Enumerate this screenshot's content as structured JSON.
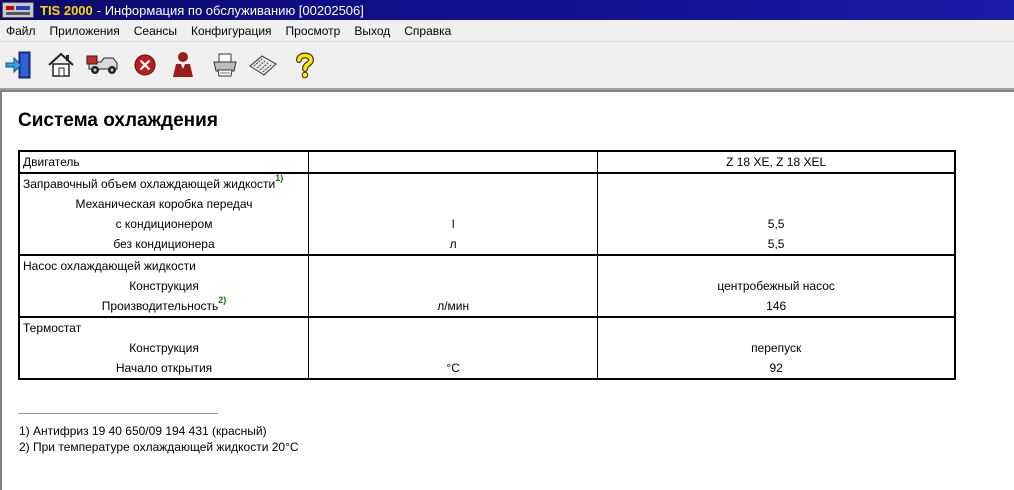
{
  "window": {
    "app_name": "TIS 2000",
    "title": "- Информация по обслуживанию [00202506]"
  },
  "menu": [
    "Файл",
    "Приложения",
    "Сеансы",
    "Конфигурация",
    "Просмотр",
    "Выход",
    "Справка"
  ],
  "toolbar": [
    {
      "icon": "exit-door-icon"
    },
    {
      "icon": "home-icon"
    },
    {
      "icon": "vehicle-icon"
    },
    {
      "icon": "stop-icon"
    },
    {
      "icon": "person-icon"
    },
    {
      "icon": "printer-icon"
    },
    {
      "icon": "keyboard-icon"
    },
    {
      "icon": "help-question-icon"
    }
  ],
  "page": {
    "title": "Система охлаждения",
    "header": {
      "col1": "Двигатель",
      "col2": "",
      "col3": "Z 18 XE, Z 18 XEL"
    },
    "groups": [
      {
        "rows": [
          {
            "label": "Заправочный объем охлаждающей жидкости",
            "sup": "1)",
            "unit": "",
            "value": ""
          },
          {
            "label": "Механическая коробка передач",
            "unit": "",
            "value": ""
          },
          {
            "label": "с кондиционером",
            "unit": "l",
            "value": "5,5"
          },
          {
            "label": "без кондиционера",
            "unit": "л",
            "value": "5,5"
          }
        ]
      },
      {
        "rows": [
          {
            "label": "Насос охлаждающей жидкости",
            "unit": "",
            "value": ""
          },
          {
            "label": "Конструкция",
            "unit": "",
            "value": "центробежный насос"
          },
          {
            "label": "Производительность",
            "sup": "2)",
            "unit": "л/мин",
            "value": "146"
          }
        ]
      },
      {
        "rows": [
          {
            "label": "Термостат",
            "unit": "",
            "value": ""
          },
          {
            "label": "Конструкция",
            "unit": "",
            "value": "перепуск"
          },
          {
            "label": "Начало открытия",
            "unit": "°C",
            "value": "92"
          }
        ]
      }
    ],
    "footnotes": [
      "1) Антифриз 19 40 650/09 194 431 (красный)",
      "2) При температуре охлаждающей жидкости 20°C"
    ]
  }
}
